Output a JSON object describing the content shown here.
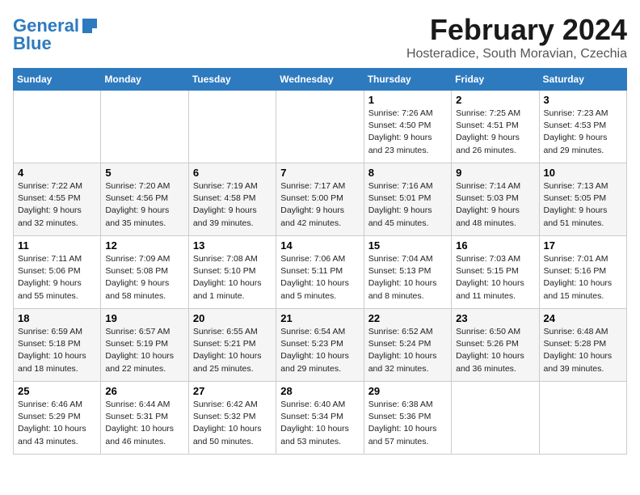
{
  "logo": {
    "line1": "General",
    "line2": "Blue"
  },
  "title": "February 2024",
  "subtitle": "Hosteradice, South Moravian, Czechia",
  "days_of_week": [
    "Sunday",
    "Monday",
    "Tuesday",
    "Wednesday",
    "Thursday",
    "Friday",
    "Saturday"
  ],
  "weeks": [
    [
      {
        "day": "",
        "info": ""
      },
      {
        "day": "",
        "info": ""
      },
      {
        "day": "",
        "info": ""
      },
      {
        "day": "",
        "info": ""
      },
      {
        "day": "1",
        "info": "Sunrise: 7:26 AM\nSunset: 4:50 PM\nDaylight: 9 hours\nand 23 minutes."
      },
      {
        "day": "2",
        "info": "Sunrise: 7:25 AM\nSunset: 4:51 PM\nDaylight: 9 hours\nand 26 minutes."
      },
      {
        "day": "3",
        "info": "Sunrise: 7:23 AM\nSunset: 4:53 PM\nDaylight: 9 hours\nand 29 minutes."
      }
    ],
    [
      {
        "day": "4",
        "info": "Sunrise: 7:22 AM\nSunset: 4:55 PM\nDaylight: 9 hours\nand 32 minutes."
      },
      {
        "day": "5",
        "info": "Sunrise: 7:20 AM\nSunset: 4:56 PM\nDaylight: 9 hours\nand 35 minutes."
      },
      {
        "day": "6",
        "info": "Sunrise: 7:19 AM\nSunset: 4:58 PM\nDaylight: 9 hours\nand 39 minutes."
      },
      {
        "day": "7",
        "info": "Sunrise: 7:17 AM\nSunset: 5:00 PM\nDaylight: 9 hours\nand 42 minutes."
      },
      {
        "day": "8",
        "info": "Sunrise: 7:16 AM\nSunset: 5:01 PM\nDaylight: 9 hours\nand 45 minutes."
      },
      {
        "day": "9",
        "info": "Sunrise: 7:14 AM\nSunset: 5:03 PM\nDaylight: 9 hours\nand 48 minutes."
      },
      {
        "day": "10",
        "info": "Sunrise: 7:13 AM\nSunset: 5:05 PM\nDaylight: 9 hours\nand 51 minutes."
      }
    ],
    [
      {
        "day": "11",
        "info": "Sunrise: 7:11 AM\nSunset: 5:06 PM\nDaylight: 9 hours\nand 55 minutes."
      },
      {
        "day": "12",
        "info": "Sunrise: 7:09 AM\nSunset: 5:08 PM\nDaylight: 9 hours\nand 58 minutes."
      },
      {
        "day": "13",
        "info": "Sunrise: 7:08 AM\nSunset: 5:10 PM\nDaylight: 10 hours\nand 1 minute."
      },
      {
        "day": "14",
        "info": "Sunrise: 7:06 AM\nSunset: 5:11 PM\nDaylight: 10 hours\nand 5 minutes."
      },
      {
        "day": "15",
        "info": "Sunrise: 7:04 AM\nSunset: 5:13 PM\nDaylight: 10 hours\nand 8 minutes."
      },
      {
        "day": "16",
        "info": "Sunrise: 7:03 AM\nSunset: 5:15 PM\nDaylight: 10 hours\nand 11 minutes."
      },
      {
        "day": "17",
        "info": "Sunrise: 7:01 AM\nSunset: 5:16 PM\nDaylight: 10 hours\nand 15 minutes."
      }
    ],
    [
      {
        "day": "18",
        "info": "Sunrise: 6:59 AM\nSunset: 5:18 PM\nDaylight: 10 hours\nand 18 minutes."
      },
      {
        "day": "19",
        "info": "Sunrise: 6:57 AM\nSunset: 5:19 PM\nDaylight: 10 hours\nand 22 minutes."
      },
      {
        "day": "20",
        "info": "Sunrise: 6:55 AM\nSunset: 5:21 PM\nDaylight: 10 hours\nand 25 minutes."
      },
      {
        "day": "21",
        "info": "Sunrise: 6:54 AM\nSunset: 5:23 PM\nDaylight: 10 hours\nand 29 minutes."
      },
      {
        "day": "22",
        "info": "Sunrise: 6:52 AM\nSunset: 5:24 PM\nDaylight: 10 hours\nand 32 minutes."
      },
      {
        "day": "23",
        "info": "Sunrise: 6:50 AM\nSunset: 5:26 PM\nDaylight: 10 hours\nand 36 minutes."
      },
      {
        "day": "24",
        "info": "Sunrise: 6:48 AM\nSunset: 5:28 PM\nDaylight: 10 hours\nand 39 minutes."
      }
    ],
    [
      {
        "day": "25",
        "info": "Sunrise: 6:46 AM\nSunset: 5:29 PM\nDaylight: 10 hours\nand 43 minutes."
      },
      {
        "day": "26",
        "info": "Sunrise: 6:44 AM\nSunset: 5:31 PM\nDaylight: 10 hours\nand 46 minutes."
      },
      {
        "day": "27",
        "info": "Sunrise: 6:42 AM\nSunset: 5:32 PM\nDaylight: 10 hours\nand 50 minutes."
      },
      {
        "day": "28",
        "info": "Sunrise: 6:40 AM\nSunset: 5:34 PM\nDaylight: 10 hours\nand 53 minutes."
      },
      {
        "day": "29",
        "info": "Sunrise: 6:38 AM\nSunset: 5:36 PM\nDaylight: 10 hours\nand 57 minutes."
      },
      {
        "day": "",
        "info": ""
      },
      {
        "day": "",
        "info": ""
      }
    ]
  ]
}
